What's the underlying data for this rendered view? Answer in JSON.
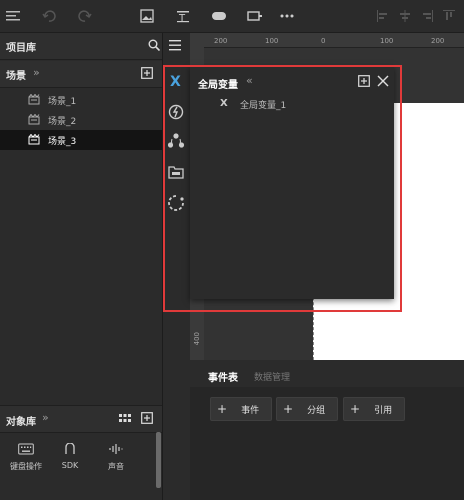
{
  "project": {
    "title": "项目库"
  },
  "scenes": {
    "title": "场景",
    "collapse_glyph": "»",
    "items": [
      {
        "label": "场景_1",
        "active": false
      },
      {
        "label": "场景_2",
        "active": false
      },
      {
        "label": "场景_3",
        "active": true
      }
    ]
  },
  "global_vars": {
    "title": "全局变量",
    "collapse_glyph": "«",
    "items": [
      {
        "label": "全局变量_1"
      }
    ]
  },
  "ruler": {
    "top_ticks": [
      "200",
      "100",
      "0",
      "100",
      "200"
    ],
    "left_ticks": [
      "400"
    ]
  },
  "event_table": {
    "tabs": [
      {
        "label": "事件表",
        "active": true
      },
      {
        "label": "数据管理",
        "active": false
      }
    ],
    "buttons": [
      {
        "label": "事件"
      },
      {
        "label": "分组"
      },
      {
        "label": "引用"
      }
    ],
    "plus_glyph": "+"
  },
  "object_library": {
    "title": "对象库",
    "collapse_glyph": "»",
    "items": [
      {
        "label": "键盘操作",
        "icon": "keyboard-icon"
      },
      {
        "label": "SDK",
        "icon": "sdk-icon"
      },
      {
        "label": "声音",
        "icon": "sound-icon"
      }
    ]
  },
  "colors": {
    "highlight_border": "#e03a3a",
    "accent_blue": "#4aa3df"
  }
}
